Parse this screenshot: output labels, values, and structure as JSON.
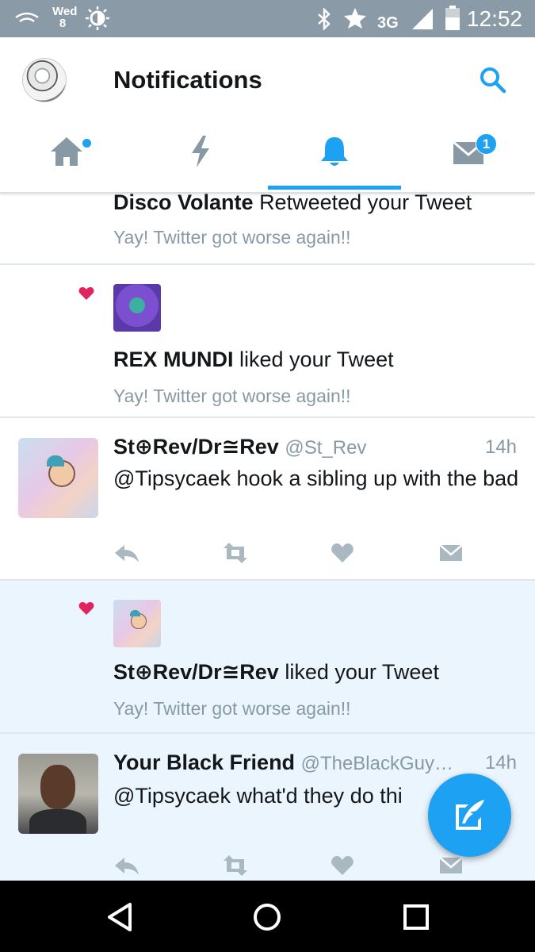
{
  "status_bar": {
    "day_name": "Wed",
    "day_number": "8",
    "network": "3G",
    "time": "12:52",
    "icons": [
      "wifi-icon",
      "brightness-icon",
      "bluetooth-icon",
      "star-icon",
      "signal-icon",
      "battery-icon"
    ]
  },
  "header": {
    "title": "Notifications",
    "search_icon": "search-icon",
    "tabs": [
      {
        "icon": "home-icon",
        "active": false,
        "has_dot": true
      },
      {
        "icon": "moments-icon",
        "active": false
      },
      {
        "icon": "notifications-icon",
        "active": true
      },
      {
        "icon": "messages-icon",
        "active": false,
        "badge": "1"
      }
    ]
  },
  "colors": {
    "accent": "#1da1f2",
    "like_red": "#e0245e",
    "muted_text": "#8899a6",
    "highlight_bg": "#eaf5fd"
  },
  "feed": {
    "items": [
      {
        "type": "retweet",
        "actor": "Disco Volante",
        "action": "Retweeted your Tweet",
        "tweet_text": "Yay! Twitter got worse again!!"
      },
      {
        "type": "like",
        "actor": "REX MUNDI",
        "action": "liked your Tweet",
        "tweet_text": "Yay! Twitter got worse again!!"
      },
      {
        "type": "tweet",
        "name": "St⊕Rev/Dr≅Rev",
        "handle": "@St_Rev",
        "time": "14h",
        "text": "@Tipsycaek hook a sibling up with the bad"
      },
      {
        "type": "like",
        "actor": "St⊕Rev/Dr≅Rev",
        "action": "liked your Tweet",
        "tweet_text": "Yay! Twitter got worse again!!",
        "highlighted": true
      },
      {
        "type": "tweet",
        "name": "Your Black Friend",
        "handle": "@TheBlackGuy…",
        "time": "14h",
        "text": "@Tipsycaek what'd they do thi",
        "highlighted": true
      }
    ]
  },
  "compose_icon": "compose-tweet-icon",
  "nav_bar": {
    "icons": [
      "back-icon",
      "home-icon",
      "recents-icon"
    ]
  }
}
